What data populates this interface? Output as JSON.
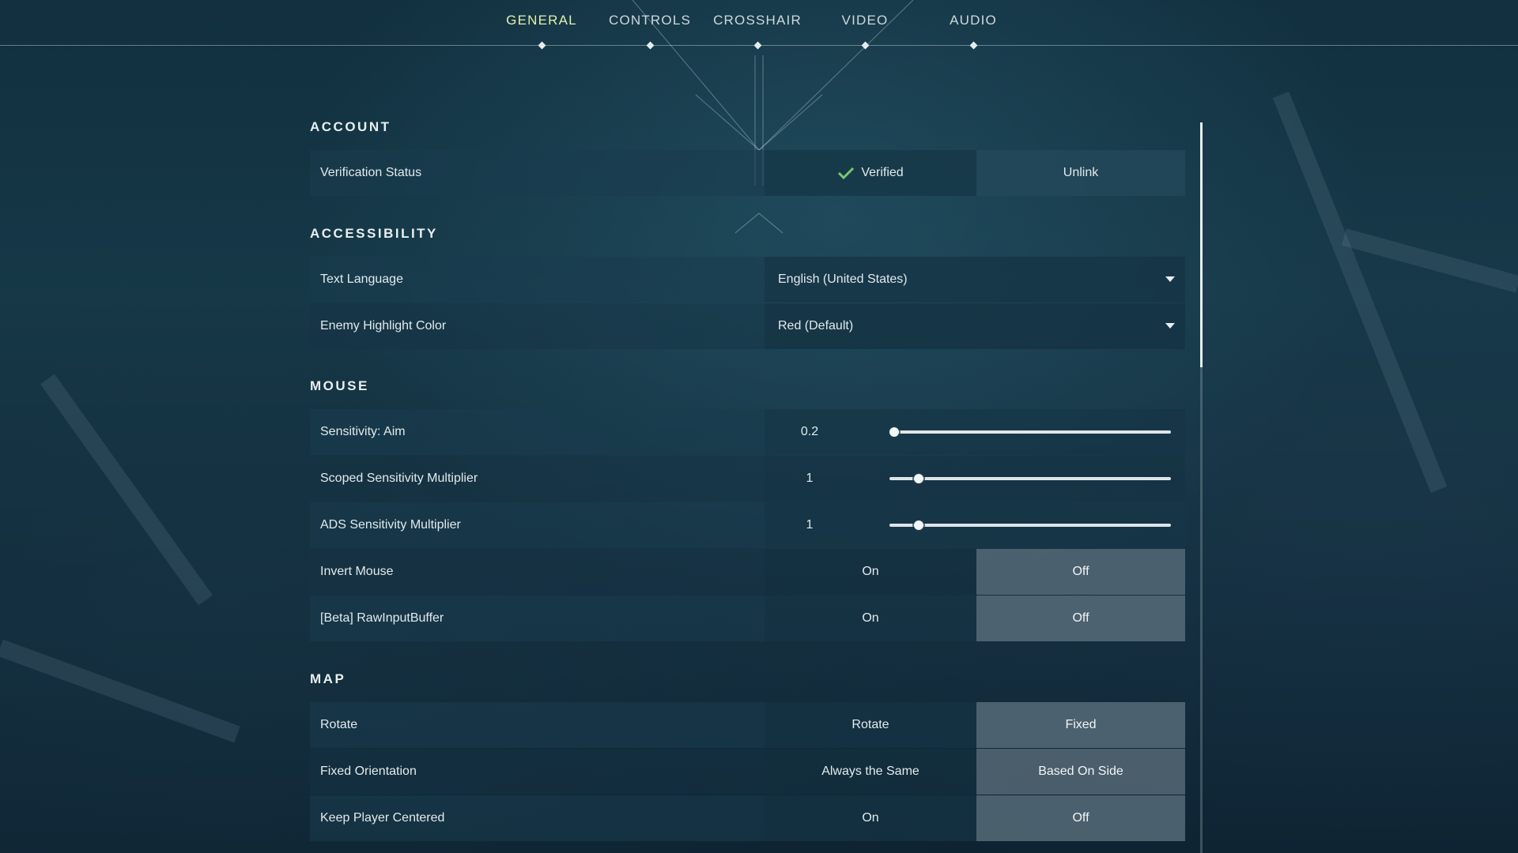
{
  "tabs": [
    {
      "label": "GENERAL",
      "active": true
    },
    {
      "label": "CONTROLS",
      "active": false
    },
    {
      "label": "CROSSHAIR",
      "active": false
    },
    {
      "label": "VIDEO",
      "active": false
    },
    {
      "label": "AUDIO",
      "active": false
    }
  ],
  "colors": {
    "active_tab": "#e6efb0",
    "verified_check": "#7bc96f"
  },
  "account": {
    "title": "ACCOUNT",
    "verification": {
      "label": "Verification Status",
      "status": "Verified",
      "status_icon": "check-icon",
      "action": "Unlink"
    }
  },
  "accessibility": {
    "title": "ACCESSIBILITY",
    "text_language": {
      "label": "Text Language",
      "value": "English (United States)"
    },
    "enemy_highlight": {
      "label": "Enemy Highlight Color",
      "value": "Red (Default)"
    }
  },
  "mouse": {
    "title": "MOUSE",
    "sensitivity_aim": {
      "label": "Sensitivity: Aim",
      "value": "0.2",
      "slider_fraction": 0.0
    },
    "scoped_mult": {
      "label": "Scoped Sensitivity Multiplier",
      "value": "1",
      "slider_fraction": 0.09
    },
    "ads_mult": {
      "label": "ADS Sensitivity Multiplier",
      "value": "1",
      "slider_fraction": 0.09
    },
    "invert_mouse": {
      "label": "Invert Mouse",
      "on": "On",
      "off": "Off",
      "selected": "Off"
    },
    "raw_input": {
      "label": "[Beta] RawInputBuffer",
      "on": "On",
      "off": "Off",
      "selected": "Off"
    }
  },
  "map": {
    "title": "MAP",
    "rotate": {
      "label": "Rotate",
      "opt1": "Rotate",
      "opt2": "Fixed",
      "selected": "Fixed"
    },
    "fixed_orientation": {
      "label": "Fixed Orientation",
      "opt1": "Always the Same",
      "opt2": "Based On Side",
      "selected": "Based On Side"
    },
    "keep_centered": {
      "label": "Keep Player Centered",
      "opt1": "On",
      "opt2": "Off",
      "selected": "Off"
    }
  }
}
